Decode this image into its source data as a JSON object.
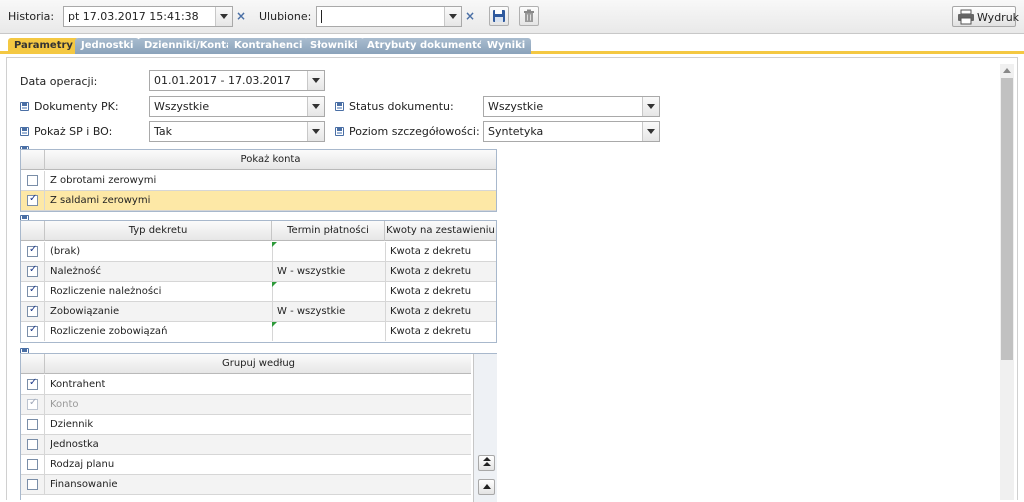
{
  "toolbar": {
    "historia_label": "Historia:",
    "historia_value": "pt 17.03.2017 15:41:38",
    "ulubione_label": "Ulubione:",
    "ulubione_value": "",
    "clear_symbol": "×",
    "print_label": "Wydruk"
  },
  "tabs": [
    {
      "label": "Parametry",
      "active": true
    },
    {
      "label": "Jednostki",
      "active": false
    },
    {
      "label": "Dzienniki/Konta",
      "active": false
    },
    {
      "label": "Kontrahenci",
      "active": false
    },
    {
      "label": "Słowniki",
      "active": false
    },
    {
      "label": "Atrybuty dokumentów",
      "active": false
    },
    {
      "label": "Wyniki",
      "active": false
    }
  ],
  "form": {
    "data_operacji": {
      "label": "Data operacji:",
      "value": "01.01.2017 - 17.03.2017"
    },
    "dokumenty_pk": {
      "label": "Dokumenty PK:",
      "value": "Wszystkie"
    },
    "status_dokumentu": {
      "label": "Status dokumentu:",
      "value": "Wszystkie"
    },
    "pokaz_sp_bo": {
      "label": "Pokaż SP i BO:",
      "value": "Tak"
    },
    "poziom": {
      "label": "Poziom szczegółowości:",
      "value": "Syntetyka"
    }
  },
  "pokaz_konta": {
    "header": "Pokaż konta",
    "rows": [
      {
        "label": "Z obrotami zerowymi",
        "checked": false
      },
      {
        "label": "Z saldami zerowymi",
        "checked": true
      }
    ]
  },
  "typ_dekretu": {
    "headers": [
      "Typ dekretu",
      "Termin płatności",
      "Kwoty na zestawieniu"
    ],
    "rows": [
      {
        "typ": "(brak)",
        "termin": "",
        "kwoty": "Kwota z dekretu",
        "checked": true
      },
      {
        "typ": "Należność",
        "termin": "W - wszystkie",
        "kwoty": "Kwota z dekretu",
        "checked": true
      },
      {
        "typ": "Rozliczenie należności",
        "termin": "",
        "kwoty": "Kwota z dekretu",
        "checked": true
      },
      {
        "typ": "Zobowiązanie",
        "termin": "W - wszystkie",
        "kwoty": "Kwota z dekretu",
        "checked": true
      },
      {
        "typ": "Rozliczenie zobowiązań",
        "termin": "",
        "kwoty": "Kwota z dekretu",
        "checked": true
      }
    ]
  },
  "grupuj": {
    "header": "Grupuj według",
    "rows": [
      {
        "label": "Kontrahent",
        "checked": true,
        "disabled": false
      },
      {
        "label": "Konto",
        "checked": true,
        "disabled": true
      },
      {
        "label": "Dziennik",
        "checked": false,
        "disabled": false
      },
      {
        "label": "Jednostka",
        "checked": false,
        "disabled": false
      },
      {
        "label": "Rodzaj planu",
        "checked": false,
        "disabled": false
      },
      {
        "label": "Finansowanie",
        "checked": false,
        "disabled": false
      }
    ]
  },
  "icons": {
    "save": "floppy-disk-icon",
    "delete": "trash-icon",
    "print": "printer-icon",
    "dropdown": "chevron-down-icon",
    "remember": "floppy-disk-icon",
    "move_top": "double-arrow-up-icon",
    "move_up": "arrow-up-icon"
  },
  "colors": {
    "active_tab": "#f4c842",
    "inactive_tab": "#8aa2ba",
    "selected_row": "#fde8a6",
    "checkbox_check": "#1f3a8a",
    "grid_border": "#a8b8cc"
  }
}
